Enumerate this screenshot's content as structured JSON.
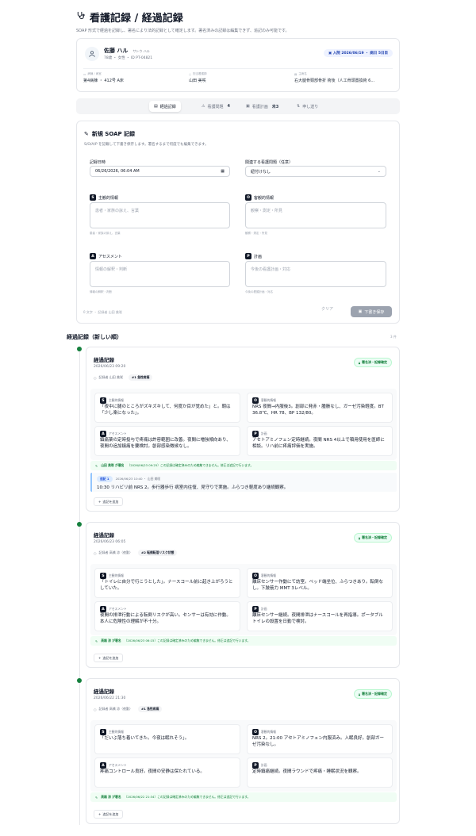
{
  "header": {
    "title": "看護記録 / 経過記録",
    "subtitle": "SOAP 形式で経過を記録し、署名により法的記録として確定します。署名済みの記録は編集できず、追記のみ可能です。"
  },
  "patient": {
    "name": "佐藤 ハル",
    "kana": "サトウ ハル",
    "meta": "78歳 ・ 女性 ・ ID PT-04821",
    "admission_badge": "入院 2026/06/19 ・ 病日 5日目",
    "ward_label": "病棟 / 病室",
    "ward_value": "第4病棟 ・ 412号 A床",
    "nurse_label": "担当看護師",
    "nurse_value": "山田 美咲",
    "diagnosis_label": "主病名",
    "diagnosis_value": "右大腿骨頸部骨折 術後（人工骨頭置換術 6..."
  },
  "tabs": [
    {
      "label": "経過記録",
      "count": ""
    },
    {
      "label": "看護問題",
      "count": "4"
    },
    {
      "label": "看護計画",
      "count": "未3"
    },
    {
      "label": "申し送り",
      "count": ""
    }
  ],
  "new_soap": {
    "title": "新規 SOAP 記録",
    "description": "S/O/A/P を記載して下書き保存します。署名するまで何度でも編集できます。",
    "datetime_label": "記録日時",
    "datetime_value": "06/26/2026, 06:04 AM",
    "problem_label": "関連する看護問題（任意）",
    "problem_value": "紐付けなし",
    "s_label": "主観的情報",
    "s_placeholder": "患者・家族の訴え、言葉",
    "s_hint": "患者・家族の訴え、言葉",
    "o_label": "客観的情報",
    "o_placeholder": "観察・測定・所見",
    "o_hint": "観察・測定・所見",
    "a_label": "アセスメント",
    "a_placeholder": "情報の解釈・判断",
    "a_hint": "情報の解釈・判断",
    "p_label": "計画",
    "p_placeholder": "今後の看護計画・対応",
    "p_hint": "今後の看護計画・対応",
    "footer_meta": "0 文字 ・ 記録者 山田 美咲",
    "clear_label": "クリア",
    "save_label": "下書き保存"
  },
  "records_section": {
    "title": "経過記録（新しい順）",
    "count": "3 件"
  },
  "letters": {
    "s": "S",
    "o": "O",
    "a": "A",
    "p": "P"
  },
  "soap_labels": {
    "s": "主観的情報",
    "o": "客観的情報",
    "a": "アセスメント",
    "p": "計画"
  },
  "entries": [
    {
      "title": "経過記録",
      "time": "2026/06/23 09:20",
      "recorder": "記録者 山田 美咲",
      "tag": "#1 急性疼痛",
      "badge": "署名済・記録確定",
      "s": "「夜中に腿のところがズキズキして、何度か目が覚めた」と。朝は「少し楽になった」。",
      "o": "NRS 夜間→内服後3。創部に発赤・腫脹なし、ガーゼ汚染軽度。BT 36.8℃、HR 78、BP 132/80。",
      "a": "鎮痛薬の定時投与で疼痛は許容範囲に改善。夜間に増強傾向あり、夜間の追加鎮痛を要検討。創部感染徴候なし。",
      "p": "アセトアミノフェン定時継続。夜間 NRS 4以上で頓用使用を医師に相談。リハ前に疼痛評価を実施。",
      "signed_by": "山田 美咲 が署名",
      "signed_note": "（2026/06/23 09:25）この記録は確定済みのため編集できません。修正は追記で行います。",
      "addendum_pill": "追記 1",
      "addendum_meta": "2026/06/23 10:40 ・ 山田 美咲",
      "addendum_body": "10:30 リハビリ前 NRS 2。歩行器歩行 病室内往復、見守りで実施。ふらつき軽度あり継続観察。",
      "add_label": "追記を追加"
    },
    {
      "title": "経過記録",
      "time": "2026/06/23 06:05",
      "recorder": "記録者 高橋 涼（夜勤）",
      "tag": "#2 転倒転落リスク状態",
      "badge": "署名済・記録確定",
      "s": "「トイレに自分で行こうとした」。ナースコール前に起き上がろうとしていた。",
      "o": "離床センサー作動にて訪室。ベッド端坐位、ふらつきあり。転倒なし。下肢筋力 MMT 3レベル。",
      "a": "夜間の排泄行動による転倒リスクが高い。センサーは有効に作動。本人に危険性の理解が不十分。",
      "p": "離床センサー継続。夜間排泄はナースコールを再指導。ポータブルトイレの設置を日勤で検討。",
      "signed_by": "高橋 涼 が署名",
      "signed_note": "（2026/06/23 06:15）この記録は確定済みのため編集できません。修正は追記で行います。",
      "add_label": "追記を追加"
    },
    {
      "title": "経過記録",
      "time": "2026/06/22 21:30",
      "recorder": "記録者 高橋 涼（夜勤）",
      "tag": "#1 急性疼痛",
      "badge": "署名済・記録確定",
      "s": "「だいぶ落ち着いてきた。今夜は眠れそう」。",
      "o": "NRS 2。21:00 アセトアミノフェン内服済み。入眠良好。創部ガーゼ汚染なし。",
      "a": "疼痛コントロール良好。夜間の安静は保たれている。",
      "p": "定時鎮痛継続。夜間ラウンドで疼痛・睡眠状況を観察。",
      "signed_by": "高橋 涼 が署名",
      "signed_note": "（2026/06/22 21:34）この記録は確定済みのため編集できません。修正は追記で行います。",
      "add_label": "追記を追加"
    }
  ]
}
